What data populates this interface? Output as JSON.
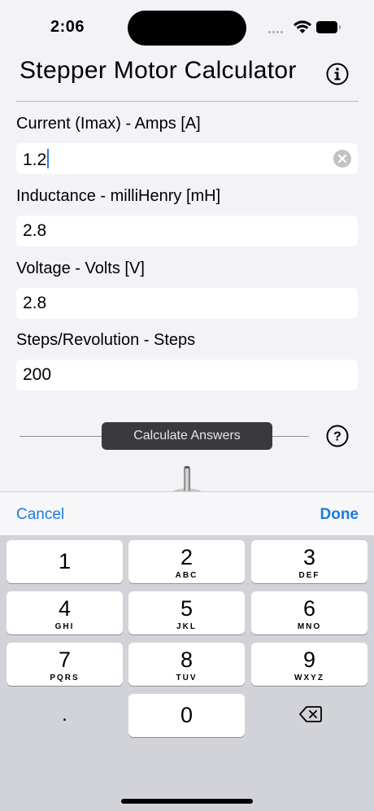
{
  "status": {
    "time": "2:06"
  },
  "header": {
    "title": "Stepper Motor Calculator",
    "info_icon": "info-circle-icon"
  },
  "fields": {
    "current": {
      "label": "Current (Imax) - Amps [A]",
      "value": "1.2"
    },
    "inductance": {
      "label": "Inductance - milliHenry [mH]",
      "value": "2.8"
    },
    "voltage": {
      "label": "Voltage - Volts [V]",
      "value": "2.8"
    },
    "steps": {
      "label": "Steps/Revolution - Steps",
      "value": "200"
    }
  },
  "actions": {
    "calculate_label": "Calculate Answers",
    "help_icon": "question-circle-icon"
  },
  "toolbar": {
    "cancel_label": "Cancel",
    "done_label": "Done"
  },
  "keypad": {
    "keys": [
      {
        "num": "1",
        "letters": ""
      },
      {
        "num": "2",
        "letters": "ABC"
      },
      {
        "num": "3",
        "letters": "DEF"
      },
      {
        "num": "4",
        "letters": "GHI"
      },
      {
        "num": "5",
        "letters": "JKL"
      },
      {
        "num": "6",
        "letters": "MNO"
      },
      {
        "num": "7",
        "letters": "PQRS"
      },
      {
        "num": "8",
        "letters": "TUV"
      },
      {
        "num": "9",
        "letters": "WXYZ"
      },
      {
        "num": "0",
        "letters": ""
      }
    ],
    "decimal": ".",
    "delete_icon": "delete-backspace-icon"
  },
  "colors": {
    "accent": "#1a7be0",
    "caret": "#3478f6",
    "button_dark": "#3a3a3c"
  }
}
